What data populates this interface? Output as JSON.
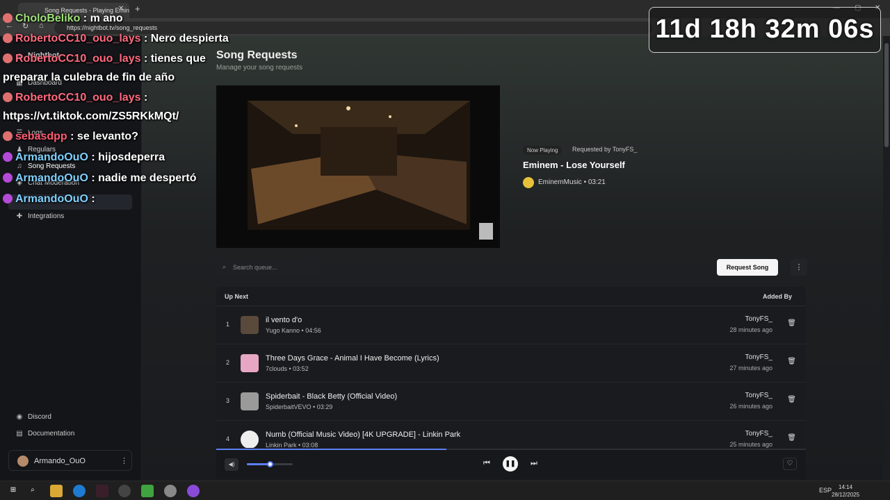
{
  "browser": {
    "tab_title": "Song Requests - Playing Emin",
    "tab_close": "✕",
    "new_tab": "+",
    "url": "https://nightbot.tv/song_requests",
    "back": "←",
    "reload": "↻",
    "home": "⌂",
    "minimize": "—",
    "maximize": "▢",
    "close": "✕"
  },
  "sidebar": {
    "items": [
      {
        "label": "Nightbot",
        "icon": "bot-icon"
      },
      {
        "label": "Dashboard",
        "icon": "grid-icon"
      },
      {
        "label": "Logs",
        "icon": "list-icon"
      },
      {
        "label": "Regulars",
        "icon": "users-icon"
      },
      {
        "label": "Song Requests",
        "icon": "headphones-icon"
      },
      {
        "label": "Chat Moderation",
        "icon": "shield-icon"
      },
      {
        "label": "Integrations",
        "icon": "puzzle-icon"
      },
      {
        "label": "Discord",
        "icon": "discord-icon"
      },
      {
        "label": "Documentation",
        "icon": "book-icon"
      }
    ],
    "user": {
      "name": "Armando_OuO",
      "more": "⋮"
    }
  },
  "page": {
    "title": "Song Requests",
    "subtitle": "Manage your song requests"
  },
  "now_playing": {
    "badge": "Now Playing",
    "requested_by": "Requested by TonyFS_",
    "title": "Eminem - Lose Yourself",
    "channel": "EminemMusic",
    "duration": "03:21",
    "meta": "EminemMusic • 03:21"
  },
  "controls": {
    "search_placeholder": "Search queue...",
    "request_button": "Request Song",
    "more": "⋮"
  },
  "queue": {
    "header_left": "Up Next",
    "header_right": "Added By",
    "rows": [
      {
        "num": "1",
        "title": "il vento d'o",
        "meta": "Yugo Kanno • 04:56",
        "user": "TonyFS_",
        "time": "28 minutes ago",
        "thumb_color": "#5a4a3c"
      },
      {
        "num": "2",
        "title": "Three Days Grace - Animal I Have Become (Lyrics)",
        "meta": "7clouds • 03:52",
        "user": "TonyFS_",
        "time": "27 minutes ago",
        "thumb_color": "#e7a6c4"
      },
      {
        "num": "3",
        "title": "Spiderbait - Black Betty (Official Video)",
        "meta": "SpiderbaitVEVO • 03:29",
        "user": "TonyFS_",
        "time": "26 minutes ago",
        "thumb_color": "#9a9a9a"
      },
      {
        "num": "4",
        "title": "Numb (Official Music Video) [4K UPGRADE] - Linkin Park",
        "meta": "Linkin Park • 03:08",
        "user": "TonyFS_",
        "time": "25 minutes ago",
        "thumb_color": "#eeeeee"
      }
    ],
    "delete_icon": "🗑"
  },
  "player": {
    "progress": 0.39,
    "volume": 0.5,
    "volume_icon": "◀)",
    "prev": "⏮",
    "pause": "❚❚",
    "next": "⏭",
    "fav": "♡"
  },
  "chat": {
    "messages": [
      {
        "user": "CholoBeliko",
        "text": ": m ano"
      },
      {
        "user": "RobertoCC10_ouo_lays",
        "text": ": Nero despierta"
      },
      {
        "user": "RobertoCC10_ouo_lays",
        "text": ": tienes que"
      },
      {
        "user": "",
        "text": "preparar la culebra de fin de año"
      },
      {
        "user": "RobertoCC10_ouo_lays",
        "text": ":"
      },
      {
        "user": "",
        "text": "https://vt.tiktok.com/ZS5RKkMQt/"
      },
      {
        "user": "sebasdpp",
        "text": ": se levanto?"
      },
      {
        "user": "ArmandoOuO",
        "text": ": hijosdeperra"
      },
      {
        "user": "ArmandoOuO",
        "text": ": nadie me despertó"
      },
      {
        "user": "ArmandoOuO",
        "text": ":"
      }
    ]
  },
  "timer": "11d 18h 32m 06s",
  "taskbar": {
    "lang": "ESP",
    "time": "14:14",
    "date": "28/12/2025",
    "start": "⊞",
    "search": "⌕"
  },
  "colors": {
    "accent": "#5b7ff2"
  }
}
